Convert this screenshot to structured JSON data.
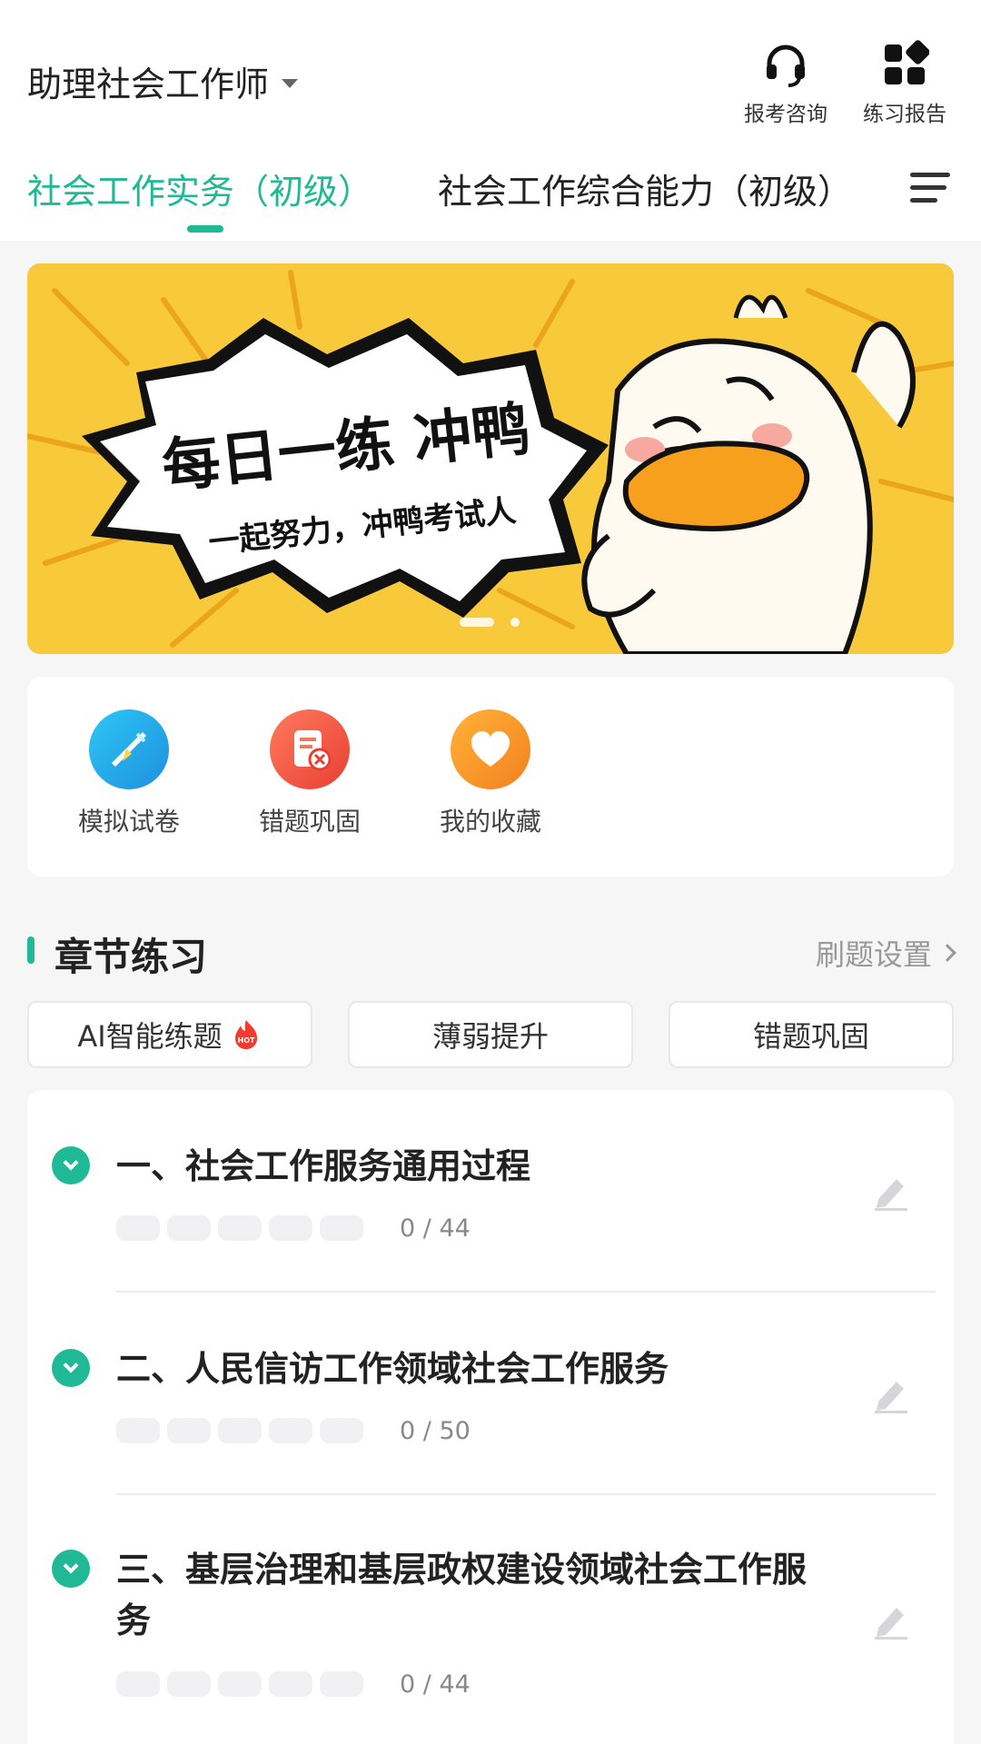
{
  "header": {
    "title": "助理社会工作师",
    "buttons": [
      {
        "label": "报考咨询",
        "icon": "headset-icon"
      },
      {
        "label": "练习报告",
        "icon": "grid-icon"
      }
    ]
  },
  "tabs": [
    {
      "label": "社会工作实务（初级）",
      "active": true
    },
    {
      "label": "社会工作综合能力（初级）",
      "active": false
    }
  ],
  "banner": {
    "headline": "每日一练 冲鸭",
    "subline": "一起努力，冲鸭考试人",
    "slides": 2,
    "active_slide": 1
  },
  "quick_actions": [
    {
      "label": "模拟试卷",
      "icon": "paper-plane-icon",
      "color": "#2ab0e8"
    },
    {
      "label": "错题巩固",
      "icon": "error-doc-icon",
      "color": "#ef5a45"
    },
    {
      "label": "我的收藏",
      "icon": "heart-icon",
      "color": "#f99a28"
    }
  ],
  "section": {
    "title": "章节练习",
    "link": "刷题设置"
  },
  "chips": [
    {
      "label": "AI智能练题",
      "badge": "HOT"
    },
    {
      "label": "薄弱提升"
    },
    {
      "label": "错题巩固"
    }
  ],
  "chapters": [
    {
      "name": "一、社会工作服务通用过程",
      "progress": "0 / 44"
    },
    {
      "name": "二、人民信访工作领域社会工作服务",
      "progress": "0 / 50"
    },
    {
      "name": "三、基层治理和基层政权建设领域社会工作服务",
      "progress": "0 / 44"
    }
  ],
  "colors": {
    "accent": "#1fb995",
    "banner": "#f7c93b"
  }
}
